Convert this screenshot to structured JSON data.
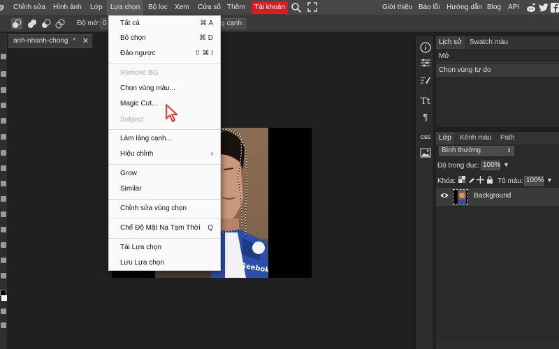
{
  "menubar": {
    "items": [
      "p",
      "Chỉnh sửa",
      "Hình ảnh",
      "Lớp",
      "Lựa chọn",
      "Bộ lọc",
      "Xem",
      "Cửa sổ",
      "Thêm"
    ],
    "account": "Tài khoản",
    "right_items": [
      "Giới thiệu",
      "Báo lỗi",
      "Hướng dẫn",
      "Blog",
      "API"
    ]
  },
  "options": {
    "feather_label": "Độ mờ:",
    "feather_value": "0",
    "edge_button": "g cạnh"
  },
  "document": {
    "tab_label": "anh-nhanh-chong",
    "modified": "*",
    "close": "✕"
  },
  "dropdown": {
    "items": [
      {
        "label": "Tất cả",
        "shortcut": "⌘ A",
        "disabled": false
      },
      {
        "label": "Bỏ chọn",
        "shortcut": "⌘ D",
        "disabled": false
      },
      {
        "label": "Đảo ngược",
        "shortcut": "⇧ ⌘ I",
        "disabled": false
      },
      {
        "label": "Remove BG",
        "shortcut": "",
        "disabled": true
      },
      {
        "label": "Chọn vùng màu...",
        "shortcut": "",
        "disabled": false
      },
      {
        "label": "Magic Cut...",
        "shortcut": "",
        "disabled": false
      },
      {
        "label": "Subject",
        "shortcut": "",
        "disabled": true
      },
      {
        "label": "Làm láng cạnh...",
        "shortcut": "",
        "disabled": false
      },
      {
        "label": "Hiệu chỉnh",
        "shortcut": "›",
        "disabled": false
      },
      {
        "label": "Grow",
        "shortcut": "",
        "disabled": false
      },
      {
        "label": "Similar",
        "shortcut": "",
        "disabled": false
      },
      {
        "label": "Chỉnh sửa vùng chọn",
        "shortcut": "",
        "disabled": false
      },
      {
        "label": "Chế Độ Mặt Nạ Tạm Thời",
        "shortcut": "Q",
        "disabled": false
      },
      {
        "label": "Tải Lựa chọn",
        "shortcut": "",
        "disabled": false
      },
      {
        "label": "Lưu Lựa chọn",
        "shortcut": "",
        "disabled": false
      }
    ]
  },
  "history_panel": {
    "tabs": [
      "Lịch sử",
      "Swatch màu"
    ],
    "rows": [
      "Mở",
      "Chọn vùng tự do"
    ]
  },
  "layers_panel": {
    "tabs": [
      "Lớp",
      "Kênh màu",
      "Path"
    ],
    "blend_mode": "Bình thường",
    "opacity_label": "Độ trong đục:",
    "opacity_value": "100%",
    "lock_label": "Khóa:",
    "fill_label": "Tô màu:",
    "fill_value": "100%",
    "layer_name": "Background"
  },
  "right_icons": [
    "info-icon",
    "sliders-icon",
    "brush-settings-icon",
    "text-icon",
    "paragraph-icon",
    "css-icon",
    "image-icon"
  ],
  "colors": {
    "accent_red": "#d51e24",
    "cursor_red": "#e53935"
  }
}
